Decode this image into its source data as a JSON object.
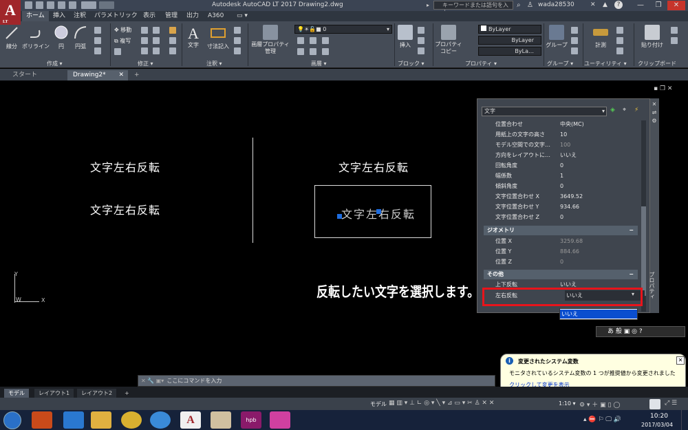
{
  "app": {
    "logo_letter": "A",
    "logo_sub": "LT",
    "title": "Autodesk AutoCAD LT 2017    Drawing2.dwg",
    "search_placeholder": "キーワードまたは語句を入力",
    "user": "wada28530",
    "min": "—",
    "restore": "❐",
    "close": "✕"
  },
  "ribbon_tabs": [
    "ホーム",
    "挿入",
    "注釈",
    "パラメトリック",
    "表示",
    "管理",
    "出力",
    "A360"
  ],
  "ribbon": {
    "draw": {
      "line": "線分",
      "polyline": "ポリライン",
      "circle": "円",
      "arc": "円弧",
      "label": "作成 ▾"
    },
    "modify": {
      "move": "移動",
      "copy": "複写",
      "label": "修正 ▾"
    },
    "annotation": {
      "text": "文字",
      "dim": "寸法記入",
      "label": "注釈 ▾"
    },
    "layers": {
      "props": "画層プロパティ\n管理",
      "layer_name": "0",
      "label": "画層 ▾"
    },
    "block": {
      "insert": "挿入",
      "label": "ブロック ▾"
    },
    "properties": {
      "match": "プロパティ\nコピー",
      "color": "ByLayer",
      "linetype": "ByLayer",
      "lineweight": "ByLa…",
      "label": "プロパティ ▾"
    },
    "groups": {
      "group": "グループ",
      "label": "グループ ▾"
    },
    "utilities": {
      "measure": "計測",
      "label": "ユーティリティ ▾"
    },
    "clipboard": {
      "paste": "貼り付け",
      "label": "クリップボード"
    }
  },
  "doc_tabs": {
    "start": "スタート",
    "drawing": "Drawing2*",
    "plus": "+"
  },
  "drawing": {
    "text_left_1": "文字左右反転",
    "text_left_2": "文字左右反転",
    "text_right_1": "文字左右反転",
    "text_selected": "文字左右反転",
    "instruction": "反転したい文字を選択します。",
    "ucs_y": "Y",
    "ucs_x": "X",
    "ucs_w": "W"
  },
  "properties_palette": {
    "object_type": "文字",
    "side_label": "プロパティ",
    "rows": [
      {
        "k": "位置合わせ",
        "v": "中央(MC)"
      },
      {
        "k": "用紙上の文字の高さ",
        "v": "10"
      },
      {
        "k": "モデル空間での文字…",
        "v": "100"
      },
      {
        "k": "方向をレイアウトに…",
        "v": "いいえ"
      },
      {
        "k": "回転角度",
        "v": "0"
      },
      {
        "k": "幅係数",
        "v": "1"
      },
      {
        "k": "傾斜角度",
        "v": "0"
      },
      {
        "k": "文字位置合わせ X",
        "v": "3649.52"
      },
      {
        "k": "文字位置合わせ Y",
        "v": "934.66"
      },
      {
        "k": "文字位置合わせ Z",
        "v": "0"
      }
    ],
    "section_geometry": "ジオメトリ",
    "geom_rows": [
      {
        "k": "位置 X",
        "v": "3259.68"
      },
      {
        "k": "位置 Y",
        "v": "884.66"
      },
      {
        "k": "位置 Z",
        "v": "0"
      }
    ],
    "section_misc": "その他",
    "misc_rows": [
      {
        "k": "上下反転",
        "v": "いいえ"
      },
      {
        "k": "左右反転",
        "v": "いいえ"
      }
    ],
    "dropdown_option": "いいえ",
    "collapse": "−"
  },
  "ime": {
    "mode": "あ 般"
  },
  "command_line": {
    "placeholder": "ここにコマンドを入力"
  },
  "layout_tabs": {
    "model": "モデル",
    "layout1": "レイアウト1",
    "layout2": "レイアウト2",
    "plus": "+"
  },
  "status_bar": {
    "model": "モデル",
    "scale": "1:10 ▾"
  },
  "notification": {
    "title": "変更されたシステム変数",
    "body": "モニタされているシステム変数の 1 つが推奨値から変更されました",
    "link": "クリックして変更を表示",
    "close": "✕"
  },
  "taskbar": {
    "time": "10:20",
    "date": "2017/03/04"
  },
  "colors": {
    "highlight_red": "#e8141b",
    "selection_blue": "#0a4ecf",
    "grip_blue": "#1e6de0"
  }
}
